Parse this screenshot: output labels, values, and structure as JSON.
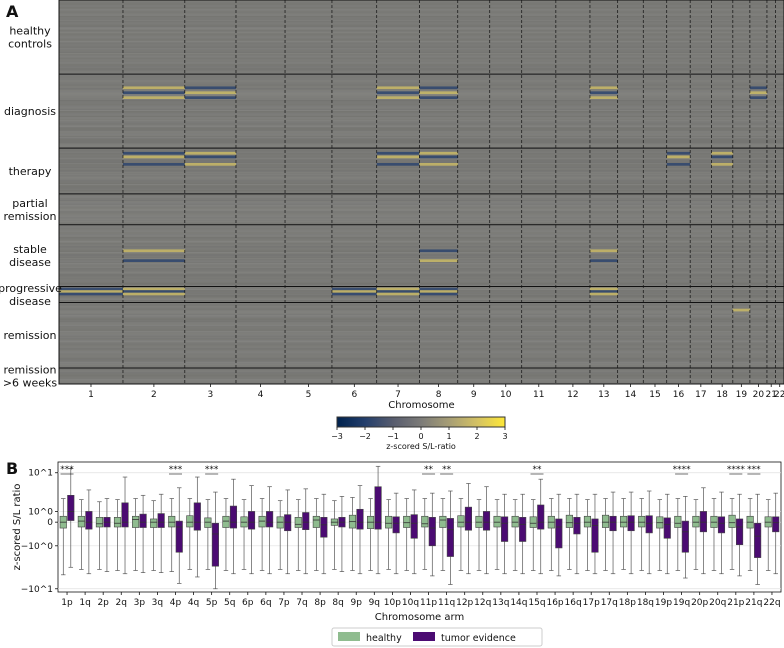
{
  "panels": {
    "a_letter": "A",
    "b_letter": "B"
  },
  "chart_data": [
    {
      "type": "heatmap",
      "panel": "A",
      "title": "",
      "xlabel": "Chromosome",
      "row_groups": [
        {
          "label": "healthy controls",
          "lines": [
            "healthy",
            "controls"
          ],
          "rows": 60
        },
        {
          "label": "diagnosis",
          "lines": [
            "diagnosis"
          ],
          "rows": 60
        },
        {
          "label": "therapy",
          "lines": [
            "therapy"
          ],
          "rows": 37
        },
        {
          "label": "partial remission",
          "lines": [
            "partial",
            "remission"
          ],
          "rows": 25
        },
        {
          "label": "stable disease",
          "lines": [
            "stable",
            "disease"
          ],
          "rows": 50
        },
        {
          "label": "progressive disease",
          "lines": [
            "progressive",
            "disease"
          ],
          "rows": 13
        },
        {
          "label": "remission",
          "lines": [
            "remission"
          ],
          "rows": 53
        },
        {
          "label": "remission >6 weeks",
          "lines": [
            "remission",
            ">6 weeks"
          ],
          "rows": 13
        }
      ],
      "chromosomes": [
        "1",
        "2",
        "3",
        "4",
        "5",
        "6",
        "7",
        "8",
        "9",
        "10",
        "11",
        "12",
        "13",
        "14",
        "15",
        "16",
        "17",
        "18",
        "19",
        "20",
        "21",
        "22"
      ],
      "chromosome_widths": [
        60,
        58,
        48,
        46,
        44,
        42,
        40,
        36,
        30,
        30,
        32,
        32,
        26,
        24,
        22,
        22,
        20,
        20,
        16,
        16,
        8,
        8
      ],
      "colorbar": {
        "label": "z-scored S/L-ratio",
        "min": -3,
        "max": 3,
        "ticks": [
          "−3",
          "−2",
          "−1",
          "0",
          "1",
          "2",
          "3"
        ],
        "colors": [
          "#00224e",
          "#233e6c",
          "#575c6e",
          "#7c7b78",
          "#a69d75",
          "#d3c164",
          "#fee838"
        ]
      }
    },
    {
      "type": "box",
      "panel": "B",
      "title": "",
      "xlabel": "Chromosome arm",
      "ylabel": "z-scored S/L ratio",
      "yscale": "symlog",
      "yticks": [
        "10^1",
        "10^0",
        "0",
        "−10^0",
        "−10^1"
      ],
      "categories": [
        "1p",
        "1q",
        "2p",
        "2q",
        "3p",
        "3q",
        "4p",
        "4q",
        "5p",
        "5q",
        "6p",
        "6q",
        "7p",
        "7q",
        "8p",
        "8q",
        "9p",
        "9q",
        "10p",
        "10q",
        "11p",
        "11q",
        "12p",
        "12q",
        "13q",
        "14q",
        "15q",
        "16p",
        "16q",
        "17p",
        "17q",
        "18p",
        "18q",
        "19p",
        "19q",
        "20p",
        "20q",
        "21p",
        "21q",
        "22q"
      ],
      "significance": [
        "***",
        "",
        "",
        "",
        "",
        "",
        "***",
        "",
        "***",
        "",
        "",
        "",
        "",
        "",
        "",
        "",
        "",
        "",
        "",
        "",
        "**",
        "**",
        "",
        "",
        "",
        "",
        "**",
        "",
        "",
        "",
        "",
        "",
        "",
        "",
        "****",
        "",
        "",
        "****",
        "***",
        ""
      ],
      "series": [
        {
          "name": "healthy",
          "color": "#8fbc8f",
          "stats": [
            [
              -4.9,
              -0.55,
              0.0,
              0.55,
              2.2
            ],
            [
              -4.4,
              -0.45,
              0.1,
              0.55,
              2.1
            ],
            [
              -4.4,
              -0.45,
              -0.15,
              0.45,
              1.9
            ],
            [
              -4.5,
              -0.45,
              -0.1,
              0.45,
              2.1
            ],
            [
              -4.5,
              -0.5,
              0.25,
              0.55,
              2.2
            ],
            [
              -4.5,
              -0.5,
              0.0,
              0.3,
              2.0
            ],
            [
              -4.6,
              -0.45,
              0.0,
              0.55,
              2.2
            ],
            [
              -4.4,
              -0.45,
              0.0,
              0.6,
              2.2
            ],
            [
              -4.4,
              -0.5,
              0.0,
              0.4,
              2.1
            ],
            [
              -4.5,
              -0.5,
              0.1,
              0.55,
              2.2
            ],
            [
              -4.4,
              -0.45,
              0.0,
              0.5,
              2.1
            ],
            [
              -4.5,
              -0.45,
              0.1,
              0.55,
              2.2
            ],
            [
              -4.4,
              -0.55,
              0.0,
              0.5,
              2.0
            ],
            [
              -4.5,
              -0.5,
              -0.2,
              0.45,
              2.1
            ],
            [
              -4.5,
              -0.5,
              0.2,
              0.55,
              2.2
            ],
            [
              -4.4,
              -0.3,
              0.0,
              0.3,
              2.0
            ],
            [
              -4.5,
              -0.55,
              0.05,
              0.65,
              2.3
            ],
            [
              -4.5,
              -0.6,
              0.0,
              0.55,
              2.2
            ],
            [
              -4.4,
              -0.55,
              -0.1,
              0.55,
              2.1
            ],
            [
              -4.5,
              -0.5,
              -0.05,
              0.55,
              2.2
            ],
            [
              -4.4,
              -0.45,
              -0.15,
              0.55,
              2.2
            ],
            [
              -4.5,
              -0.5,
              0.2,
              0.55,
              2.2
            ],
            [
              -4.5,
              -0.45,
              0.0,
              0.6,
              2.2
            ],
            [
              -4.5,
              -0.5,
              0.0,
              0.55,
              2.1
            ],
            [
              -4.4,
              -0.45,
              0.0,
              0.55,
              2.1
            ],
            [
              -4.5,
              -0.45,
              0.0,
              0.55,
              2.1
            ],
            [
              -4.5,
              -0.5,
              -0.1,
              0.5,
              2.1
            ],
            [
              -4.5,
              -0.55,
              0.0,
              0.55,
              2.2
            ],
            [
              -4.4,
              -0.5,
              -0.05,
              0.65,
              2.2
            ],
            [
              -4.5,
              -0.45,
              0.0,
              0.55,
              2.1
            ],
            [
              -4.5,
              -0.5,
              0.0,
              0.65,
              2.2
            ],
            [
              -4.4,
              -0.45,
              0.0,
              0.55,
              2.2
            ],
            [
              -4.5,
              -0.45,
              0.0,
              0.55,
              2.2
            ],
            [
              -4.5,
              -0.55,
              -0.05,
              0.5,
              2.1
            ],
            [
              -4.5,
              -0.5,
              -0.1,
              0.55,
              2.2
            ],
            [
              -4.4,
              -0.45,
              0.0,
              0.55,
              2.1
            ],
            [
              -4.5,
              -0.5,
              0.0,
              0.55,
              2.2
            ],
            [
              -4.4,
              -0.5,
              -0.05,
              0.65,
              2.2
            ],
            [
              -4.5,
              -0.55,
              0.0,
              0.55,
              2.2
            ],
            [
              -4.5,
              -0.45,
              0.0,
              0.5,
              2.1
            ]
          ]
        },
        {
          "name": "tumor evidence",
          "color": "#4b0b72",
          "stats": [
            [
              -4.2,
              0.15,
              1.0,
              2.5,
              5.0
            ],
            [
              -4.8,
              -0.65,
              0.0,
              1.0,
              3.0
            ],
            [
              -4.6,
              -0.45,
              0.0,
              0.45,
              2.2
            ],
            [
              -4.8,
              -0.45,
              0.0,
              1.8,
              4.2
            ],
            [
              -4.7,
              -0.5,
              0.0,
              0.75,
              2.5
            ],
            [
              -4.7,
              -0.5,
              0.0,
              0.8,
              2.6
            ],
            [
              -5.7,
              -2.8,
              -0.45,
              0.1,
              3.2
            ],
            [
              -5.1,
              -0.75,
              0.0,
              1.8,
              4.2
            ],
            [
              -6.2,
              -4.1,
              -1.1,
              -0.1,
              2.8
            ],
            [
              -4.8,
              -0.55,
              0.0,
              1.5,
              4.0
            ],
            [
              -4.8,
              -0.65,
              0.0,
              1.0,
              3.4
            ],
            [
              -4.8,
              -0.45,
              0.0,
              1.0,
              3.3
            ],
            [
              -4.8,
              -0.8,
              0.0,
              0.7,
              3.0
            ],
            [
              -4.8,
              -0.7,
              0.0,
              0.9,
              3.1
            ],
            [
              -4.8,
              -1.4,
              -0.25,
              0.45,
              2.6
            ],
            [
              -4.6,
              -0.45,
              0.0,
              0.45,
              2.4
            ],
            [
              -4.8,
              -0.65,
              0.0,
              1.2,
              3.4
            ],
            [
              -4.8,
              -0.65,
              0.0,
              3.3,
              5.2
            ],
            [
              -4.8,
              -1.0,
              -0.1,
              0.5,
              2.7
            ],
            [
              -4.8,
              -1.5,
              -0.1,
              0.7,
              3.0
            ],
            [
              -5.0,
              -2.2,
              -0.55,
              0.45,
              2.7
            ],
            [
              -5.8,
              -3.2,
              -0.7,
              0.35,
              2.9
            ],
            [
              -4.8,
              -0.75,
              0.0,
              1.4,
              3.6
            ],
            [
              -4.8,
              -0.75,
              0.0,
              1.0,
              3.3
            ],
            [
              -4.8,
              -1.8,
              -0.1,
              0.5,
              2.6
            ],
            [
              -4.8,
              -1.8,
              -0.2,
              0.45,
              2.6
            ],
            [
              -4.8,
              -0.65,
              0.0,
              1.6,
              4.0
            ],
            [
              -5.0,
              -2.4,
              -0.45,
              0.3,
              2.6
            ],
            [
              -4.8,
              -1.1,
              -0.1,
              0.45,
              2.6
            ],
            [
              -4.8,
              -2.8,
              -0.3,
              0.3,
              2.6
            ],
            [
              -4.8,
              -0.8,
              0.0,
              0.55,
              2.8
            ],
            [
              -4.8,
              -0.8,
              0.0,
              0.6,
              2.8
            ],
            [
              -4.8,
              -1.0,
              -0.1,
              0.6,
              2.9
            ],
            [
              -4.8,
              -1.5,
              -0.2,
              0.4,
              2.6
            ],
            [
              -5.2,
              -2.8,
              -0.9,
              0.1,
              2.4
            ],
            [
              -4.8,
              -0.9,
              0.0,
              1.0,
              3.2
            ],
            [
              -4.8,
              -1.0,
              -0.1,
              0.5,
              2.8
            ],
            [
              -5.0,
              -2.1,
              -0.45,
              0.3,
              2.6
            ],
            [
              -5.8,
              -3.3,
              -1.3,
              -0.1,
              2.6
            ],
            [
              -4.8,
              -0.9,
              -0.05,
              0.5,
              2.7
            ]
          ]
        }
      ]
    }
  ],
  "legend": {
    "items": [
      {
        "label": "healthy",
        "color": "#8fbc8f"
      },
      {
        "label": "tumor evidence",
        "color": "#4b0b72"
      }
    ]
  }
}
